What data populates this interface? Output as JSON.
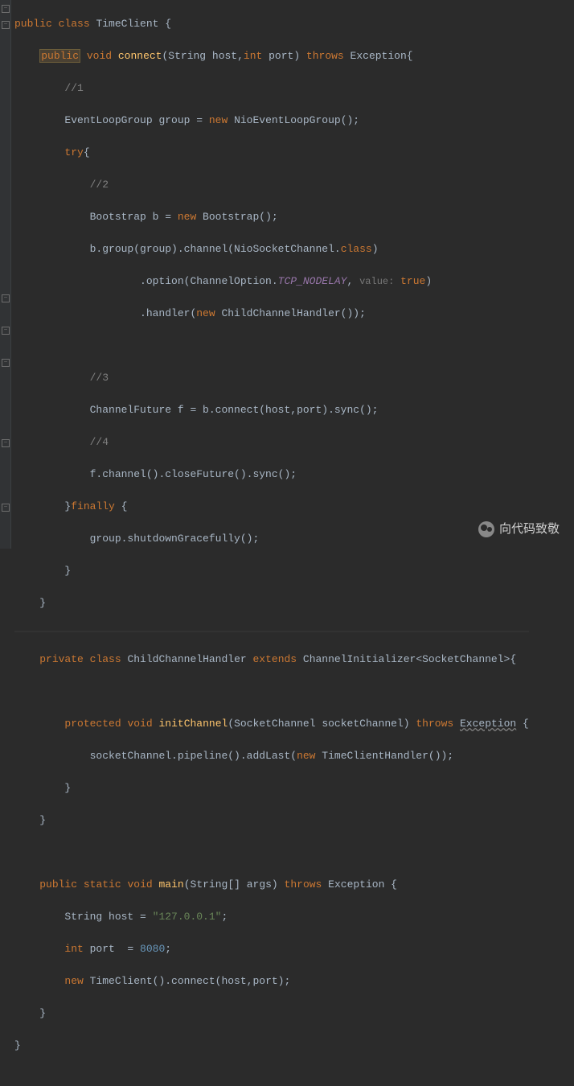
{
  "code": {
    "l1_public": "public",
    "l1_class": "class",
    "l1_name": "TimeClient {",
    "l2_public": "public",
    "l2_void": "void",
    "l2_method": "connect",
    "l2_sig1": "(String host,",
    "l2_int": "int",
    "l2_sig2": " port) ",
    "l2_throws": "throws",
    "l2_exc": " Exception{",
    "l3_comment": "//1",
    "l4_a": "EventLoopGroup group = ",
    "l4_new": "new",
    "l4_b": " NioEventLoopGroup();",
    "l5_try": "try",
    "l5_brace": "{",
    "l6_comment": "//2",
    "l7_a": "Bootstrap b = ",
    "l7_new": "new",
    "l7_b": " Bootstrap();",
    "l8_a": "b.group(group).channel(NioSocketChannel.",
    "l8_class": "class",
    "l8_b": ")",
    "l9_a": ".option(ChannelOption.",
    "l9_field": "TCP_NODELAY",
    "l9_b": ", ",
    "l9_hint": "value:",
    "l9_true": " true",
    "l9_c": ")",
    "l10_a": ".handler(",
    "l10_new": "new",
    "l10_b": " ChildChannelHandler());",
    "l12_comment": "//3",
    "l13_a": "ChannelFuture f = b.connect(host,port).sync();",
    "l14_comment": "//4",
    "l15_a": "f.channel().closeFuture().sync();",
    "l16_a": "}",
    "l16_finally": "finally",
    "l16_b": " {",
    "l17_a": "group.shutdownGracefully();",
    "l18_a": "}",
    "l19_a": "}",
    "l21_private": "private",
    "l21_class": "class",
    "l21_name": " ChildChannelHandler ",
    "l21_extends": "extends",
    "l21_parent": " ChannelInitializer<SocketChannel>{",
    "l23_protected": "protected",
    "l23_void": "void",
    "l23_method": "initChannel",
    "l23_sig": "(SocketChannel socketChannel) ",
    "l23_throws": "throws",
    "l23_exc": "Exception",
    "l23_brace": " {",
    "l24_a": "socketChannel.pipeline().addLast(",
    "l24_new": "new",
    "l24_b": " TimeClientHandler());",
    "l25_a": "}",
    "l26_a": "}",
    "l28_public": "public",
    "l28_static": "static",
    "l28_void": "void",
    "l28_method": "main",
    "l28_sig": "(String[] args) ",
    "l28_throws": "throws",
    "l28_exc": " Exception {",
    "l29_a": "String host = ",
    "l29_str": "\"127.0.0.1\"",
    "l29_b": ";",
    "l30_int": "int",
    "l30_a": " port  = ",
    "l30_num": "8080",
    "l30_b": ";",
    "l31_new": "new",
    "l31_a": " TimeClient().connect(host,port);",
    "l32_a": "}",
    "l33_a": "}"
  },
  "watermark": "向代码致敬"
}
